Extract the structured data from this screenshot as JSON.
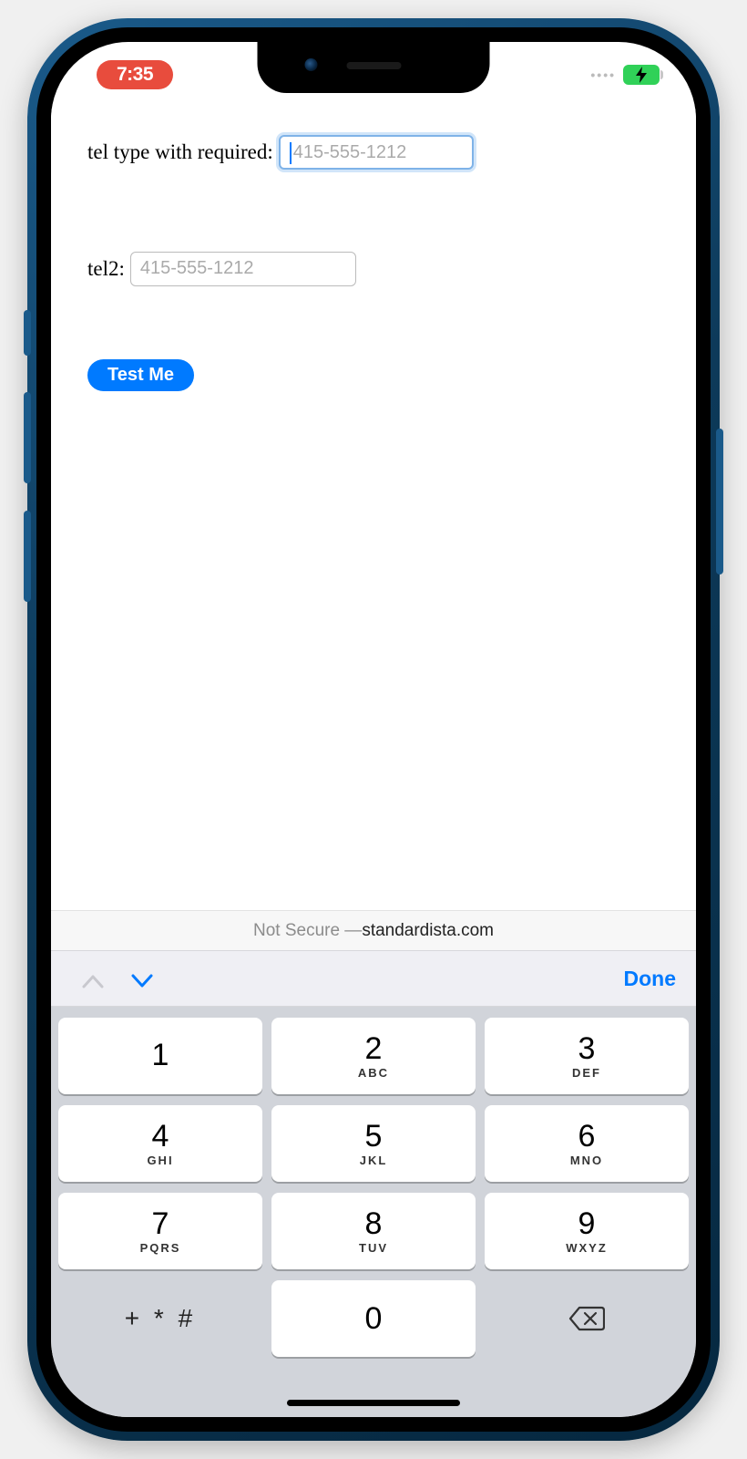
{
  "status": {
    "time": "7:35"
  },
  "form": {
    "field1": {
      "label": "tel type with required: ",
      "placeholder": "415-555-1212"
    },
    "field2": {
      "label": "tel2: ",
      "placeholder": "415-555-1212"
    },
    "button": "Test Me"
  },
  "urlbar": {
    "prefix": "Not Secure — ",
    "domain": "standardista.com"
  },
  "accessory": {
    "done": "Done"
  },
  "keypad": {
    "k1": {
      "n": "1",
      "s": ""
    },
    "k2": {
      "n": "2",
      "s": "ABC"
    },
    "k3": {
      "n": "3",
      "s": "DEF"
    },
    "k4": {
      "n": "4",
      "s": "GHI"
    },
    "k5": {
      "n": "5",
      "s": "JKL"
    },
    "k6": {
      "n": "6",
      "s": "MNO"
    },
    "k7": {
      "n": "7",
      "s": "PQRS"
    },
    "k8": {
      "n": "8",
      "s": "TUV"
    },
    "k9": {
      "n": "9",
      "s": "WXYZ"
    },
    "sym": "+ * #",
    "k0": "0"
  }
}
